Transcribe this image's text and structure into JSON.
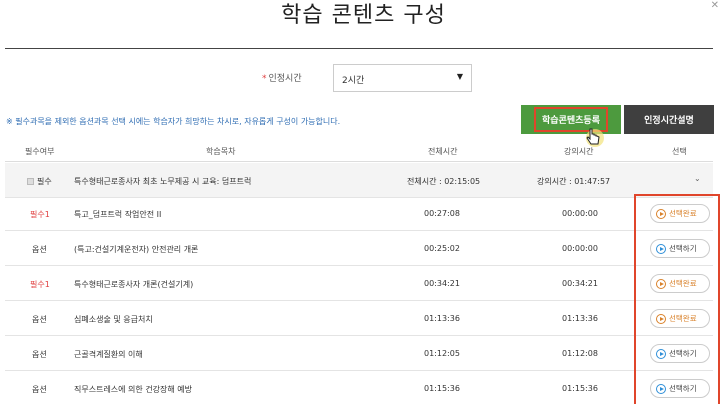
{
  "page_title": "학습 콘텐츠 구성",
  "certification": {
    "required_mark": "*",
    "label": "인정시간",
    "selected_value": "2시간"
  },
  "notice": "※ 필수과목을 제외한 옵션과목 선택 시에는 학습자가 희망하는 차시로, 자유롭게 구성이 가능합니다.",
  "buttons": {
    "register": "학습콘텐츠등록",
    "explain": "인정시간설명"
  },
  "table": {
    "headers": {
      "required": "필수여부",
      "title": "학습목차",
      "total_time": "전체시간",
      "lecture_time": "강의시간",
      "select": "선택"
    },
    "summary": {
      "required": "필수",
      "title": "특수형태근로종사자 최초 노무제공 시 교육: 덤프트럭",
      "total_time": "전체시간 : 02:15:05",
      "lecture_time": "강의시간 : 01:47:57"
    },
    "rows": [
      {
        "required": "필수1",
        "title": "특고_덤프트럭 작업안전 II",
        "total_time": "00:27:08",
        "lecture_time": "00:00:00",
        "action": "선택완료"
      },
      {
        "required": "옵션",
        "title": "(특고:건설기계운전자) 안전관리 개론",
        "total_time": "00:25:02",
        "lecture_time": "00:00:00",
        "action": "선택하기"
      },
      {
        "required": "필수1",
        "title": "특수형태근로종사자 개론(건설기계)",
        "total_time": "00:34:21",
        "lecture_time": "00:34:21",
        "action": "선택완료"
      },
      {
        "required": "옵션",
        "title": "심폐소생술 및 응급처치",
        "total_time": "01:13:36",
        "lecture_time": "01:13:36",
        "action": "선택완료"
      },
      {
        "required": "옵션",
        "title": "근골격계질환의 이해",
        "total_time": "01:12:05",
        "lecture_time": "01:12:08",
        "action": "선택하기"
      },
      {
        "required": "옵션",
        "title": "직무스트레스에 의한 건강장해 예방",
        "total_time": "01:15:36",
        "lecture_time": "01:15:36",
        "action": "선택하기"
      }
    ]
  },
  "colors": {
    "accent_green": "#4d9a3e",
    "dark_button": "#3f3f3f",
    "highlight_red": "#e0452b",
    "required_red": "#e04040",
    "done_orange": "#d9822b",
    "select_blue": "#2f8fd8"
  }
}
